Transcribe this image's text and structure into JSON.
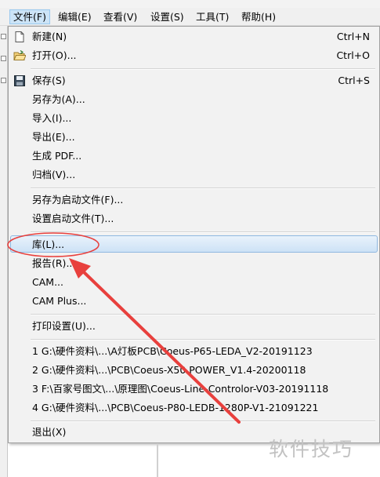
{
  "menubar": {
    "items": [
      {
        "label": "文件(F)"
      },
      {
        "label": "编辑(E)"
      },
      {
        "label": "查看(V)"
      },
      {
        "label": "设置(S)"
      },
      {
        "label": "工具(T)"
      },
      {
        "label": "帮助(H)"
      }
    ]
  },
  "file_menu": {
    "new": {
      "label": "新建(N)",
      "shortcut": "Ctrl+N"
    },
    "open": {
      "label": "打开(O)...",
      "shortcut": "Ctrl+O"
    },
    "save": {
      "label": "保存(S)",
      "shortcut": "Ctrl+S"
    },
    "save_as": {
      "label": "另存为(A)..."
    },
    "import": {
      "label": "导入(I)..."
    },
    "export": {
      "label": "导出(E)..."
    },
    "generate_pdf": {
      "label": "生成 PDF..."
    },
    "archive": {
      "label": "归档(V)..."
    },
    "save_as_startup": {
      "label": "另存为启动文件(F)..."
    },
    "set_startup": {
      "label": "设置启动文件(T)..."
    },
    "library": {
      "label": "库(L)..."
    },
    "report": {
      "label": "报告(R)..."
    },
    "cam": {
      "label": "CAM..."
    },
    "cam_plus": {
      "label": "CAM Plus..."
    },
    "print_setup": {
      "label": "打印设置(U)..."
    },
    "recent": [
      {
        "label": "1 G:\\硬件资料\\...\\A灯板PCB\\Coeus-P65-LEDA_V2-20191123"
      },
      {
        "label": "2 G:\\硬件资料\\...\\PCB\\Coeus-X50 POWER_V1.4-20200118"
      },
      {
        "label": "3 F:\\百家号图文\\...\\原理图\\Coeus-Line-Controlor-V03-20191118"
      },
      {
        "label": "4 G:\\硬件资料\\...\\PCB\\Coeus-P80-LEDB-1280P-V1-21091221"
      }
    ],
    "exit": {
      "label": "退出(X)"
    }
  },
  "colors": {
    "highlight_border": "#8fb8e0",
    "annotation_red": "#e8403d",
    "menubar_open": "#cce4f7"
  },
  "watermark": {
    "text": "软件技巧"
  }
}
